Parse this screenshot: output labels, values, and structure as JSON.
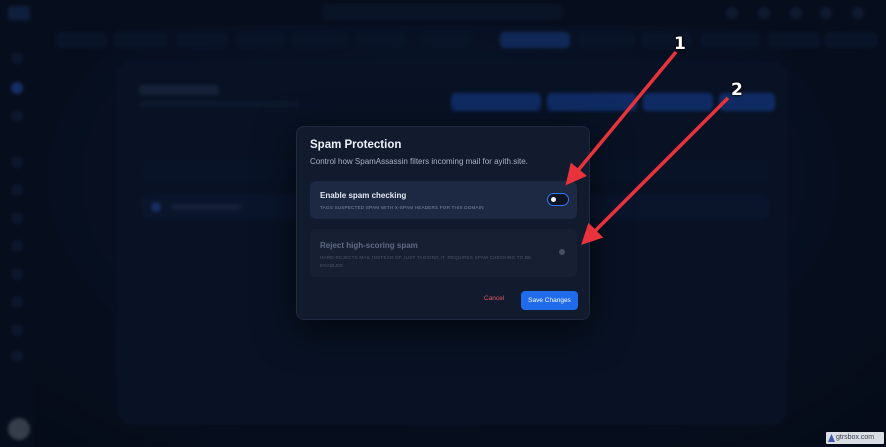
{
  "modal": {
    "title": "Spam Protection",
    "subtitle": "Control how SpamAssassin filters incoming mail for ayith.site.",
    "options": [
      {
        "label": "Enable spam checking",
        "description": "TAGS SUSPECTED SPAM WITH X-SPAM HEADERS FOR THIS DOMAIN",
        "enabled": true,
        "disabled": false
      },
      {
        "label": "Reject high-scoring spam",
        "description": "HARD-REJECTS MAIL INSTEAD OF JUST TAGGING IT. REQUIRES SPAM CHECKING TO BE ENABLED.",
        "enabled": false,
        "disabled": true
      }
    ],
    "cancel_label": "Cancel",
    "save_label": "Save Changes"
  },
  "annotations": [
    {
      "number": "1"
    },
    {
      "number": "2"
    }
  ],
  "watermark": {
    "text": "gtrsbox.com"
  },
  "colors": {
    "accent": "#1f6bea",
    "toggle_on_border": "#2f7bf0",
    "cancel": "#e05a5a",
    "annotation_arrow": "#e8333d",
    "modal_bg": "#121a2e"
  },
  "icons": {
    "watermark_logo": "triangle-logo-icon"
  }
}
